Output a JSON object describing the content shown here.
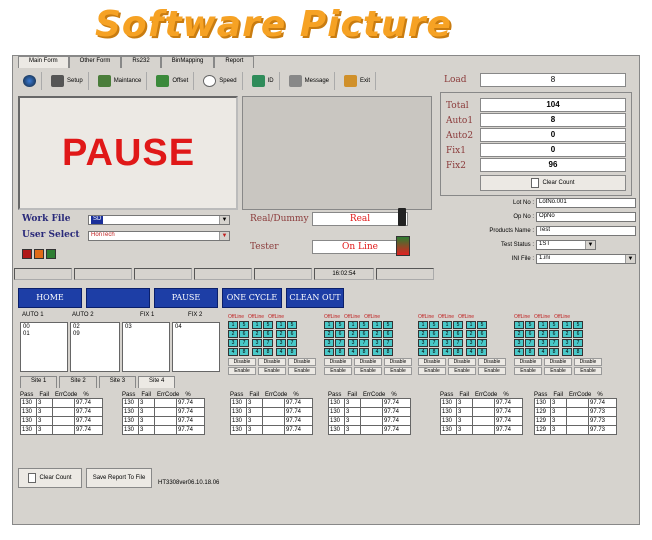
{
  "header": {
    "title": "Software Picture"
  },
  "tabs": [
    "Main Form",
    "Other Form",
    "Rs232",
    "BinMapping",
    "Report"
  ],
  "toolbar": [
    {
      "label": "Setup",
      "icon": "globe-icon"
    },
    {
      "label": "Setup",
      "icon": "wrench-icon"
    },
    {
      "label": "Maintance",
      "icon": "truck-icon"
    },
    {
      "label": "Offset",
      "icon": "tool-icon"
    },
    {
      "label": "Speed",
      "icon": "clock-icon"
    },
    {
      "label": "ID",
      "icon": "id-card-icon"
    },
    {
      "label": "Message",
      "icon": "message-icon"
    },
    {
      "label": "Exit",
      "icon": "exit-icon"
    }
  ],
  "status": {
    "main": "PAUSE",
    "real_dummy_label": "Real/Dummy",
    "real_dummy_value": "Real",
    "tester_label": "Tester",
    "tester_value": "On Line",
    "time": "16:02:54"
  },
  "work": {
    "file_label": "Work File",
    "file_value": "SD",
    "user_label": "User Select",
    "user_value": "HonTech"
  },
  "counts": {
    "load_label": "Load",
    "load_value": "8",
    "items": [
      {
        "label": "Total",
        "value": "104"
      },
      {
        "label": "Auto1",
        "value": "8"
      },
      {
        "label": "Auto2",
        "value": "0"
      },
      {
        "label": "Fix1",
        "value": "0"
      },
      {
        "label": "Fix2",
        "value": "96"
      }
    ],
    "clear_label": "Clear Count"
  },
  "info": [
    {
      "label": "Lot No :",
      "value": "LotNo.001"
    },
    {
      "label": "Op No :",
      "value": "OpNo"
    },
    {
      "label": "Products Name :",
      "value": "Test"
    },
    {
      "label": "Test Status :",
      "value": "1ST"
    },
    {
      "label": "INI File :",
      "value": "1.ini"
    }
  ],
  "buttons": {
    "home": "HOME",
    "blank": "",
    "pause": "PAUSE",
    "one_cycle": "ONE CYCLE",
    "clean_out": "CLEAN OUT"
  },
  "lists": [
    {
      "title": "AUTO 1",
      "lines": [
        "00",
        "01"
      ]
    },
    {
      "title": "AUTO 2",
      "lines": [
        "02",
        "09"
      ]
    },
    {
      "title": "FIX 1",
      "lines": [
        "03"
      ]
    },
    {
      "title": "FIX 2",
      "lines": [
        "04"
      ]
    }
  ],
  "site_tabs": [
    "Site 1",
    "Site 2",
    "Site 3",
    "Site 4"
  ],
  "sites": {
    "offline": "OffLine",
    "cells": [
      "1",
      "5",
      "2",
      "6",
      "3",
      "7",
      "4",
      "8"
    ],
    "disable": "Disable",
    "enable": "Enable"
  },
  "table_head": [
    "Pass",
    "Fail",
    "ErrCode",
    "%"
  ],
  "tables": [
    [
      [
        "130",
        "3",
        "",
        "97.74"
      ],
      [
        "130",
        "3",
        "",
        "97.74"
      ],
      [
        "130",
        "3",
        "",
        "97.74"
      ],
      [
        "130",
        "3",
        "",
        "97.74"
      ]
    ],
    [
      [
        "130",
        "3",
        "",
        "97.74"
      ],
      [
        "130",
        "3",
        "",
        "97.74"
      ],
      [
        "130",
        "3",
        "",
        "97.74"
      ],
      [
        "130",
        "3",
        "",
        "97.74"
      ]
    ],
    [
      [
        "130",
        "3",
        "",
        "97.74"
      ],
      [
        "130",
        "3",
        "",
        "97.74"
      ],
      [
        "130",
        "3",
        "",
        "97.74"
      ],
      [
        "130",
        "3",
        "",
        "97.74"
      ]
    ],
    [
      [
        "130",
        "3",
        "",
        "97.74"
      ],
      [
        "130",
        "3",
        "",
        "97.74"
      ],
      [
        "130",
        "3",
        "",
        "97.74"
      ],
      [
        "130",
        "3",
        "",
        "97.74"
      ]
    ],
    [
      [
        "130",
        "3",
        "",
        "97.74"
      ],
      [
        "130",
        "3",
        "",
        "97.74"
      ],
      [
        "130",
        "3",
        "",
        "97.74"
      ],
      [
        "130",
        "3",
        "",
        "97.74"
      ]
    ],
    [
      [
        "130",
        "3",
        "",
        "97.74"
      ],
      [
        "130",
        "3",
        "",
        "97.74"
      ],
      [
        "130",
        "3",
        "",
        "97.74"
      ],
      [
        "130",
        "3",
        "",
        "97.74"
      ]
    ],
    [
      [
        "130",
        "3",
        "",
        "97.74"
      ],
      [
        "129",
        "3",
        "",
        "97.73"
      ],
      [
        "129",
        "3",
        "",
        "97.73"
      ],
      [
        "129",
        "3",
        "",
        "97.73"
      ]
    ]
  ],
  "footer": {
    "clear": "Clear Count",
    "save": "Save Report To File",
    "version": "HT3308ver06.10.18.06"
  }
}
